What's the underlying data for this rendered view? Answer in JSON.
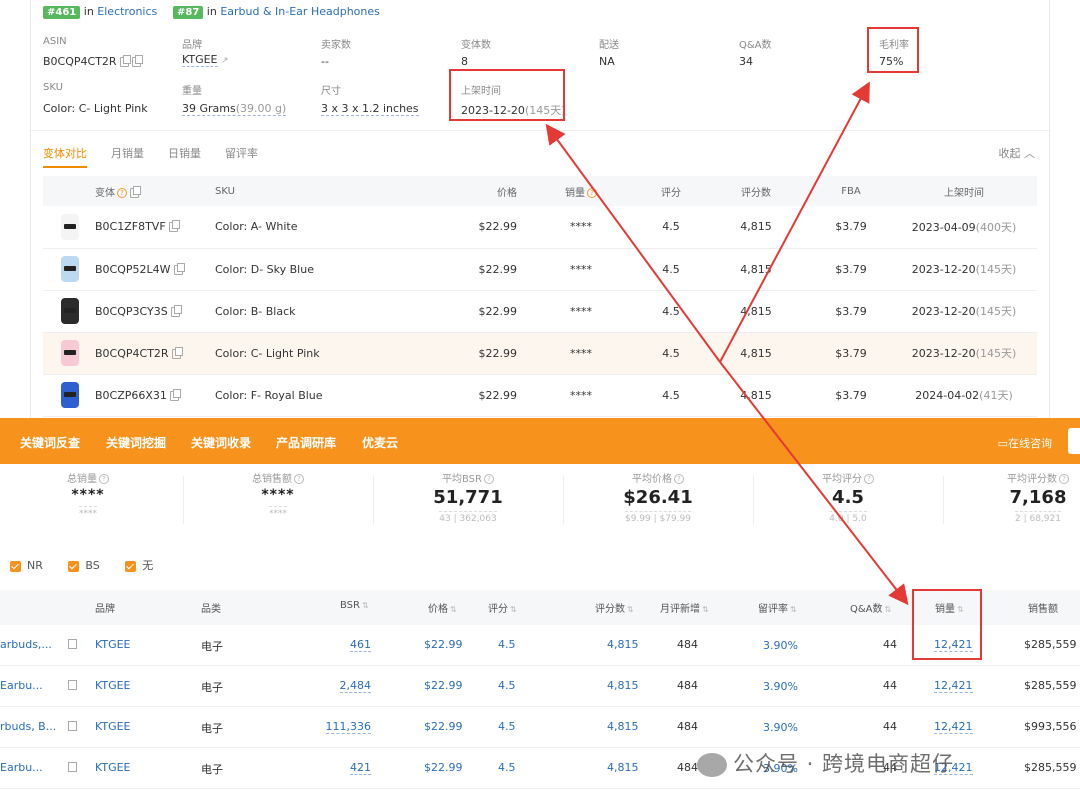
{
  "ranks": [
    {
      "badge": "#461",
      "in": "in",
      "category": "Electronics"
    },
    {
      "badge": "#87",
      "in": "in",
      "category": "Earbud & In-Ear Headphones"
    }
  ],
  "info": {
    "asin_label": "ASIN",
    "asin": "B0CQP4CT2R",
    "brand_label": "品牌",
    "brand": "KTGEE",
    "sellers_label": "卖家数",
    "sellers": "--",
    "variants_label": "变体数",
    "variants": "8",
    "delivery_label": "配送",
    "delivery": "NA",
    "qa_label": "Q&A数",
    "qa": "34",
    "margin_label": "毛利率",
    "margin": "75%",
    "sku_label": "SKU",
    "sku": "Color: C- Light Pink",
    "weight_label": "重量",
    "weight": "39 Grams",
    "weight_sub": "(39.00 g)",
    "size_label": "尺寸",
    "size": "3 x 3 x 1.2 inches",
    "listed_label": "上架时间",
    "listed": "2023-12-20",
    "listed_sub": "(145天)"
  },
  "tabs": [
    "变体对比",
    "月销量",
    "日销量",
    "留评率"
  ],
  "collapse": "收起",
  "variant_headers": [
    "变体",
    "SKU",
    "价格",
    "销量",
    "评分",
    "评分数",
    "FBA",
    "上架时间"
  ],
  "variants": [
    {
      "asin": "B0C1ZF8TVF",
      "sku": "Color: A- White",
      "price": "$22.99",
      "sales": "****",
      "rating": "4.5",
      "reviews": "4,815",
      "fba": "$3.79",
      "date": "2023-04-09",
      "days": "(400天)",
      "color": "#f4f4f4"
    },
    {
      "asin": "B0CQP52L4W",
      "sku": "Color: D- Sky Blue",
      "price": "$22.99",
      "sales": "****",
      "rating": "4.5",
      "reviews": "4,815",
      "fba": "$3.79",
      "date": "2023-12-20",
      "days": "(145天)",
      "color": "#bcd9f2"
    },
    {
      "asin": "B0CQP3CY3S",
      "sku": "Color: B- Black",
      "price": "$22.99",
      "sales": "****",
      "rating": "4.5",
      "reviews": "4,815",
      "fba": "$3.79",
      "date": "2023-12-20",
      "days": "(145天)",
      "color": "#2b2b2b"
    },
    {
      "asin": "B0CQP4CT2R",
      "sku": "Color: C- Light Pink",
      "price": "$22.99",
      "sales": "****",
      "rating": "4.5",
      "reviews": "4,815",
      "fba": "$3.79",
      "date": "2023-12-20",
      "days": "(145天)",
      "color": "#f6c9d4"
    },
    {
      "asin": "B0CZP66X31",
      "sku": "Color: F- Royal Blue",
      "price": "$22.99",
      "sales": "****",
      "rating": "4.5",
      "reviews": "4,815",
      "fba": "$3.79",
      "date": "2024-04-02",
      "days": "(41天)",
      "color": "#2d5fd0"
    }
  ],
  "nav": [
    "关键词反查",
    "关键词挖掘",
    "关键词收录",
    "产品调研库",
    "优麦云"
  ],
  "consult": "在线咨询",
  "stats": [
    {
      "label": "总销量",
      "value": "****",
      "range": "****"
    },
    {
      "label": "总销售额",
      "value": "****",
      "range": "****"
    },
    {
      "label": "平均BSR",
      "value": "51,771",
      "range": "43 | 362,063"
    },
    {
      "label": "平均价格",
      "value": "$26.41",
      "range": "$9.99 | $79.99"
    },
    {
      "label": "平均评分",
      "value": "4.5",
      "range": "4.0 | 5.0"
    },
    {
      "label": "平均评分数",
      "value": "7,168",
      "range": "2 | 68,921"
    }
  ],
  "filters": [
    "NR",
    "BS",
    "无"
  ],
  "bottom_headers": [
    "品牌",
    "品类",
    "BSR",
    "价格",
    "评分",
    "评分数",
    "月评新增",
    "留评率",
    "Q&A数",
    "销量",
    "销售额"
  ],
  "bottom_rows": [
    {
      "title": "arbuds,...",
      "brand": "KTGEE",
      "cat": "电子",
      "bsr": "461",
      "price": "$22.99",
      "rating": "4.5",
      "reviews": "4,815",
      "new": "484",
      "rate": "3.90%",
      "qa": "44",
      "sales": "12,421",
      "revenue": "$285,559"
    },
    {
      "title": "Earbu...",
      "brand": "KTGEE",
      "cat": "电子",
      "bsr": "2,484",
      "price": "$22.99",
      "rating": "4.5",
      "reviews": "4,815",
      "new": "484",
      "rate": "3.90%",
      "qa": "44",
      "sales": "12,421",
      "revenue": "$285,559"
    },
    {
      "title": "rbuds, B...",
      "brand": "KTGEE",
      "cat": "电子",
      "bsr": "111,336",
      "price": "$22.99",
      "rating": "4.5",
      "reviews": "4,815",
      "new": "484",
      "rate": "3.90%",
      "qa": "44",
      "sales": "12,421",
      "revenue": "$993,556"
    },
    {
      "title": "Earbu...",
      "brand": "KTGEE",
      "cat": "电子",
      "bsr": "421",
      "price": "$22.99",
      "rating": "4.5",
      "reviews": "4,815",
      "new": "484",
      "rate": "3.90%",
      "qa": "44",
      "sales": "12,421",
      "revenue": "$285,559"
    }
  ],
  "watermark": "公众号 · 跨境电商超仔",
  "colors": {
    "accent": "#f7921c",
    "link": "#2a6ebb",
    "annotation": "#e53935",
    "rank_badge": "#58b85d"
  }
}
